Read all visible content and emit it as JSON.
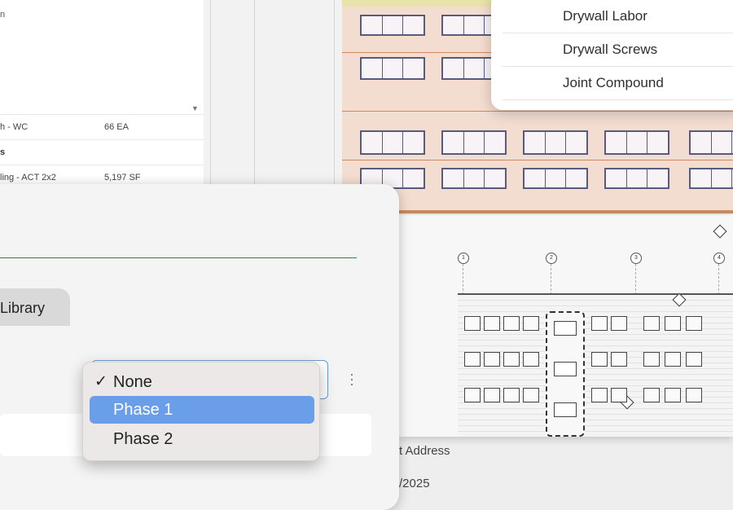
{
  "background_list": {
    "fragment_text": "n",
    "rows": [
      {
        "name": "h - WC",
        "qty": "66 EA",
        "header": false
      },
      {
        "name": "s",
        "qty": "",
        "header": true
      },
      {
        "name": "ling - ACT 2x2",
        "qty": "5,197 SF",
        "header": false
      }
    ]
  },
  "materials_menu": {
    "items": [
      "Drywall Labor",
      "Drywall Screws",
      "Joint Compound"
    ]
  },
  "dialog": {
    "tab_label": "Library",
    "phase_select": {
      "selected": "Phase 1"
    }
  },
  "phase_menu": {
    "options": [
      {
        "label": "None",
        "checked": true,
        "highlighted": false
      },
      {
        "label": "Phase 1",
        "checked": false,
        "highlighted": true
      },
      {
        "label": "Phase 2",
        "checked": false,
        "highlighted": false
      }
    ],
    "check_glyph": "✓"
  },
  "behind_panel": {
    "address_label": "t Address",
    "date_fragment": "/2025"
  },
  "colors": {
    "highlight": "#6a9ee8",
    "select_border": "#6e98d1",
    "divider_green": "#3d7d4c"
  }
}
